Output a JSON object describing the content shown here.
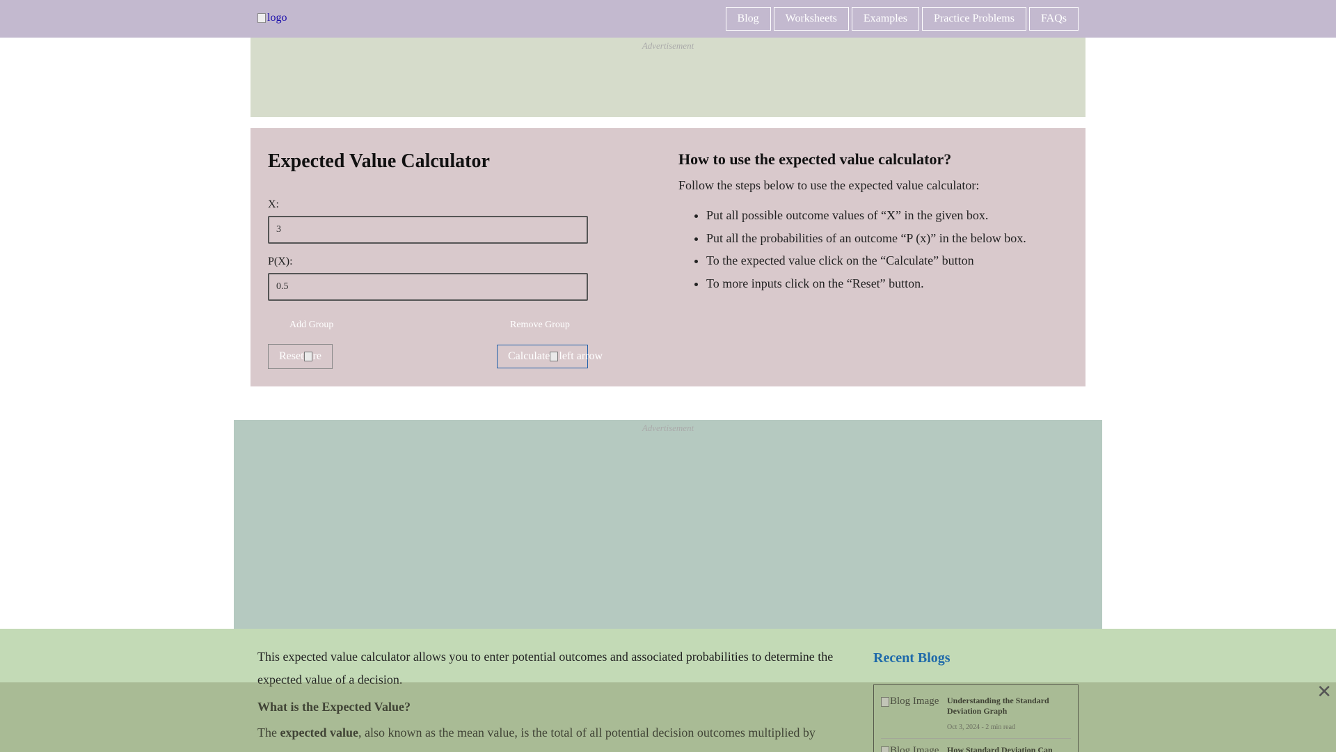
{
  "header": {
    "logo_alt": "logo",
    "nav": [
      "Blog",
      "Worksheets",
      "Examples",
      "Practice Problems",
      "FAQs"
    ]
  },
  "ads": {
    "label": "Advertisement"
  },
  "calculator": {
    "title": "Expected Value Calculator",
    "x_label": "X:",
    "x_value": "3",
    "px_label": "P(X):",
    "px_value": "0.5",
    "add_group": "Add Group",
    "remove_group": "Remove Group",
    "reset": "Reset",
    "reset_img_alt": "re",
    "calculate": "Calculate",
    "calculate_img_alt": "left arrow"
  },
  "howto": {
    "title": "How to use the expected value calculator?",
    "intro": "Follow the steps below to use the expected value calculator:",
    "steps": [
      "Put all possible outcome values of “X” in the given box.",
      "Put all the probabilities of an outcome “P (x)” in the below box.",
      "To the expected value click on the “Calculate” button",
      "To more inputs click on the “Reset” button."
    ]
  },
  "content": {
    "intro": "This expected value calculator allows you to enter potential outcomes and associated probabilities to determine the expected value of a decision.",
    "section_heading": "What is the Expected Value?",
    "para_start": "The ",
    "para_bold": "expected value",
    "para_rest": ", also known as the mean value, is the total of all potential decision outcomes multiplied by"
  },
  "recent_blogs": {
    "title": "Recent Blogs",
    "img_alt": "Blog Image",
    "items": [
      {
        "title": "Understanding the Standard Deviation Graph",
        "meta": "Oct 3, 2024 - 2 min read"
      },
      {
        "title": "How Standard Deviation Can",
        "meta": ""
      }
    ]
  },
  "overlay": {
    "close_glyph": "✕"
  }
}
